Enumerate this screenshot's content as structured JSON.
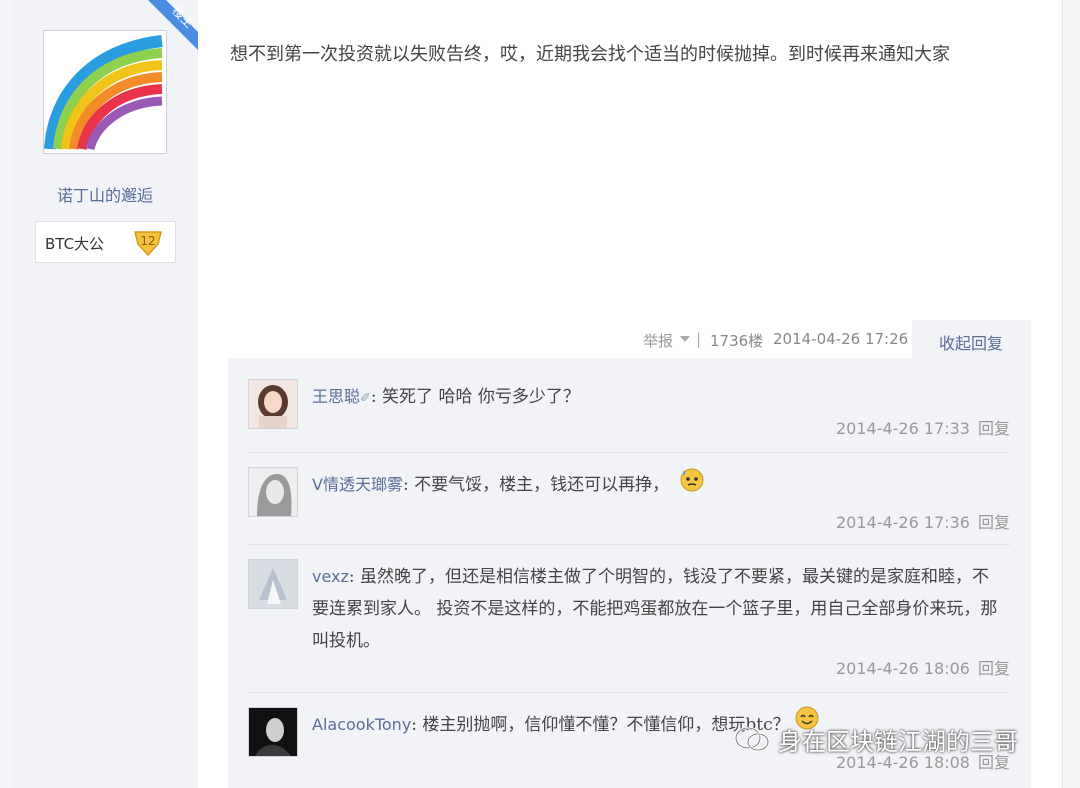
{
  "post": {
    "author": "诺丁山的邂逅",
    "badge": {
      "label": "BTC大公",
      "level": "12"
    },
    "corner_label": "楼主",
    "content": "想不到第一次投资就以失败告终，哎，近期我会找个适当的时候抛掉。到时候再来通知大家",
    "meta": {
      "report": "举报",
      "separator": "|",
      "floor": "1736楼",
      "time": "2014-04-26 17:26"
    },
    "collapse_label": "收起回复"
  },
  "replies": [
    {
      "user": "王思聪",
      "text": ": 笑死了 哈哈 你亏多少了？",
      "time": "2014-4-26 17:33",
      "reply_label": "回复"
    },
    {
      "user": "V情透天瑯雾",
      "text": ": 不要气馁，楼主，钱还可以再挣，",
      "time": "2014-4-26 17:36",
      "reply_label": "回复"
    },
    {
      "user": "vexz",
      "text": ": 虽然晚了，但还是相信楼主做了个明智的，钱没了不要紧，最关键的是家庭和睦，不要连累到家人。 投资不是这样的，不能把鸡蛋都放在一个篮子里，用自己全部身价来玩，那叫投机。",
      "time": "2014-4-26 18:06",
      "reply_label": "回复"
    },
    {
      "user": "AlacookTony",
      "text": ": 楼主别抛啊，信仰懂不懂？不懂信仰，想玩btc？",
      "time": "2014-4-26 18:08",
      "reply_label": "回复"
    }
  ],
  "watermark": "身在区块链江湖的三哥"
}
